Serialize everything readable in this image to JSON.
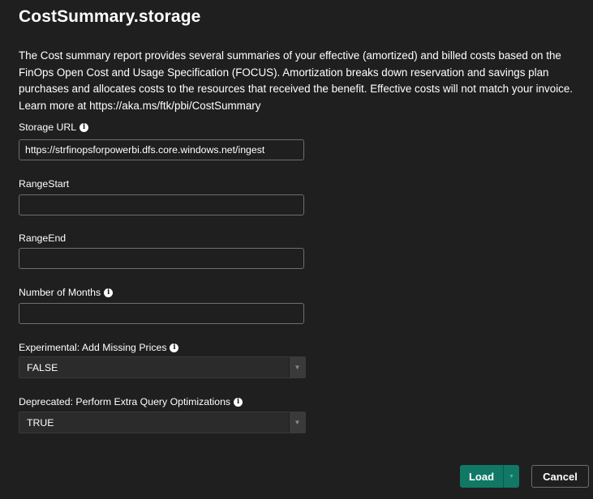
{
  "dialog": {
    "title": "CostSummary.storage",
    "description": "The Cost summary report provides several summaries of your effective (amortized) and billed costs based on the FinOps Open Cost and Usage Specification (FOCUS). Amortization breaks down reservation and savings plan purchases and allocates costs to the resources that received the benefit. Effective costs will not match your invoice. Learn more at https://aka.ms/ftk/pbi/CostSummary"
  },
  "fields": {
    "storage_url": {
      "label": "Storage URL",
      "value": "https://strfinopsforpowerbi.dfs.core.windows.net/ingest",
      "info_icon": "info-icon"
    },
    "range_start": {
      "label": "RangeStart",
      "value": ""
    },
    "range_end": {
      "label": "RangeEnd",
      "value": ""
    },
    "number_of_months": {
      "label": "Number of Months",
      "value": "",
      "info_icon": "info-icon"
    },
    "add_missing_prices": {
      "label": "Experimental: Add Missing Prices",
      "selected": "FALSE",
      "info_icon": "info-icon"
    },
    "extra_query_optimizations": {
      "label": "Deprecated: Perform Extra Query Optimizations",
      "selected": "TRUE",
      "info_icon": "info-icon"
    }
  },
  "buttons": {
    "load_label": "Load",
    "cancel_label": "Cancel"
  },
  "colors": {
    "background": "#1f1f1f",
    "primary_button": "#117865",
    "input_border": "#6e6e6e",
    "select_background": "#2b2b2b"
  }
}
